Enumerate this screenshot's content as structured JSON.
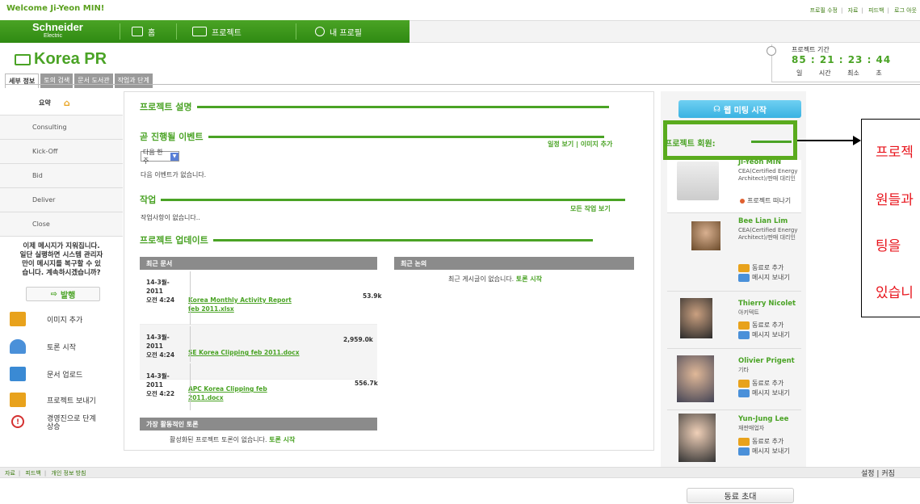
{
  "header": {
    "welcome": "Welcome Ji-Yeon MIN!",
    "links": [
      "프로필 수정",
      "자료",
      "피드백",
      "로그 아웃"
    ]
  },
  "nav": {
    "logo_main": "Schneider",
    "logo_sub": "Electric",
    "items": [
      {
        "label": "홈",
        "icon": "home-icon"
      },
      {
        "label": "프로젝트",
        "icon": "folder-icon"
      },
      {
        "label": "내 프로필",
        "icon": "profile-icon"
      }
    ]
  },
  "project": {
    "title": "Korea PR",
    "tabs": [
      "세부 정보",
      "토의 검색",
      "문서 도서관",
      "작업과 단계"
    ]
  },
  "timer": {
    "label": "프로젝트 기간",
    "values": "85 : 21 : 23 : 44",
    "units": "일 시간 최소 초"
  },
  "sidebar": {
    "summary": "요약",
    "phases": [
      "Consulting",
      "Kick-Off",
      "Bid",
      "Deliver",
      "Close"
    ],
    "notice": [
      "이제 메시지가 지워집니다.",
      "일단 실행하면 시스템 관리자",
      "만이 메시지를 복구할 수 있",
      "습니다. 계속하시겠습니까?"
    ],
    "publish": "발행",
    "actions": [
      {
        "label": "이미지 추가",
        "icon": "image-grid-icon",
        "color": "#e8a21c"
      },
      {
        "label": "토론 시작",
        "icon": "person-icon",
        "color": "#4a90d9"
      },
      {
        "label": "문서 업로드",
        "icon": "upload-icon",
        "color": "#3a8ad4"
      },
      {
        "label": "프로젝트 보내기",
        "icon": "send-icon",
        "color": "#e8a21c"
      },
      {
        "label": "경영진으로 단계 상승",
        "icon": "alert-icon",
        "color": "#d43030"
      }
    ]
  },
  "main": {
    "description_title": "프로젝트 설명",
    "events_title": "곧 진행될 이벤트",
    "events_links": "일정 보기 | 이미지 추가",
    "events_select": "다음 한 주",
    "events_empty": "다음 이벤트가 없습니다.",
    "tasks_title": "작업",
    "tasks_link": "모든 작업 보기",
    "tasks_empty": "작업사항이 없습니다..",
    "updates_title": "프로젝트 업데이트",
    "recent_docs_head": "최근 문서",
    "recent_talks_head": "최근 논의",
    "recent_talks_empty": "최근 게시글이 없습니다.",
    "start_talk": "토론 시작",
    "docs": [
      {
        "date1": "14-3월-",
        "date2": "2011",
        "date3": "오전 4:24",
        "name": "Korea Monthly Activity Report feb 2011.xlsx",
        "size": "53.9k"
      },
      {
        "date1": "14-3월-",
        "date2": "2011",
        "date3": "오전 4:24",
        "name": "SE Korea Clipping feb 2011.docx",
        "size": "2,959.0k"
      },
      {
        "date1": "14-3월-",
        "date2": "2011",
        "date3": "오전 4:22",
        "name": "APC Korea Clipping feb 2011.docx",
        "size": "556.7k"
      }
    ],
    "active_head": "가장 활동적인 토론",
    "active_empty": "활성화된 프로젝트 토론이 없습니다."
  },
  "members": {
    "web_meeting": "웹 미팅 시작",
    "title": "프로젝트 회원:",
    "list": [
      {
        "name": "Ji-Yeon MIN",
        "role": "CEA(Certified Energy Architect)/판매 대리인",
        "actions": [
          "프로젝트 떠나기"
        ]
      },
      {
        "name": "Bee Lian Lim",
        "role": "CEA(Certified Energy Architect)/판매 대리인",
        "actions": [
          "동료로 추가",
          "메시지 보내기"
        ]
      },
      {
        "name": "Thierry Nicolet",
        "role": "아키텍트",
        "actions": [
          "동료로 추가",
          "메시지 보내기"
        ]
      },
      {
        "name": "Olivier Prigent",
        "role": "기타",
        "actions": [
          "동료로 추가",
          "메시지 보내기"
        ]
      },
      {
        "name": "Yun-Jung Lee",
        "role": "재판매업자",
        "actions": [
          "동료로 추가",
          "메시지 보내기"
        ]
      }
    ],
    "invite": "동료 초대"
  },
  "footer": {
    "links": [
      "자료",
      "피드백",
      "개인 정보 방침"
    ],
    "right": "설정 | 커짐"
  },
  "callout": {
    "lines": [
      "프로젝",
      "원들과",
      "팅을",
      "있습니"
    ]
  }
}
